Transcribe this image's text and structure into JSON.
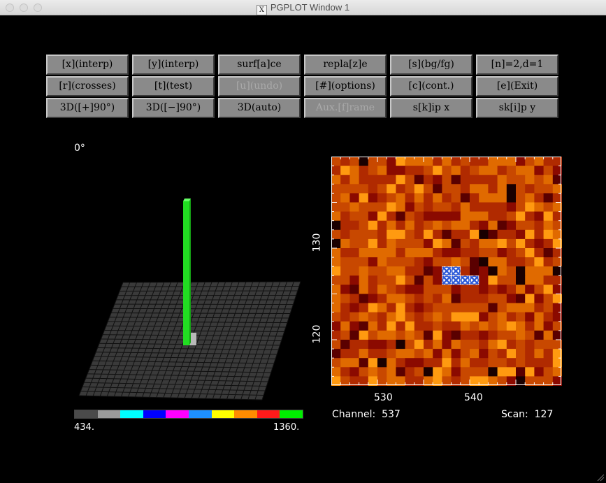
{
  "window": {
    "title": "PGPLOT Window 1",
    "x_icon": "X"
  },
  "buttons": [
    {
      "label": "[x](interp)",
      "enabled": true
    },
    {
      "label": "[y](interp)",
      "enabled": true
    },
    {
      "label": "surf[a]ce",
      "enabled": true
    },
    {
      "label": "repla[z]e",
      "enabled": true
    },
    {
      "label": "[s](bg/fg)",
      "enabled": true
    },
    {
      "label": "[n]=2,d=1",
      "enabled": true
    },
    {
      "label": "[r](crosses)",
      "enabled": true
    },
    {
      "label": "[t](test)",
      "enabled": true
    },
    {
      "label": "[u](undo)",
      "enabled": false
    },
    {
      "label": "[#](options)",
      "enabled": true
    },
    {
      "label": "[c](cont.)",
      "enabled": true
    },
    {
      "label": "[e](Exit)",
      "enabled": true
    },
    {
      "label": "3D([+]90°)",
      "enabled": true
    },
    {
      "label": "3D([−]90°)",
      "enabled": true
    },
    {
      "label": "3D(auto)",
      "enabled": true
    },
    {
      "label": "Aux.[f]rame",
      "enabled": false
    },
    {
      "label": "s[k]ip x",
      "enabled": true
    },
    {
      "label": "sk[i]p y",
      "enabled": true
    }
  ],
  "surface_plot": {
    "angle_label": "0°",
    "surface_color": "#3a3a3a",
    "spike_color": "#22dd22",
    "colorbar": {
      "colors": [
        "#4a4a4a",
        "#9a9a9a",
        "#00ffff",
        "#0000ff",
        "#ff00ff",
        "#1e90ff",
        "#ffff00",
        "#ff8c00",
        "#ff1a1a",
        "#00ee00"
      ],
      "min_label": "434.",
      "max_label": "1360."
    }
  },
  "heatmap": {
    "x_ticks": [
      "530",
      "540"
    ],
    "y_ticks": [
      "130",
      "120"
    ],
    "channel_label": "Channel:  537",
    "scan_label": "Scan:  127",
    "palette": [
      "#5a0000",
      "#8b0a00",
      "#b02a00",
      "#c84800",
      "#e06a00",
      "#ff9a10"
    ],
    "marker_color": "#2a58d8"
  }
}
